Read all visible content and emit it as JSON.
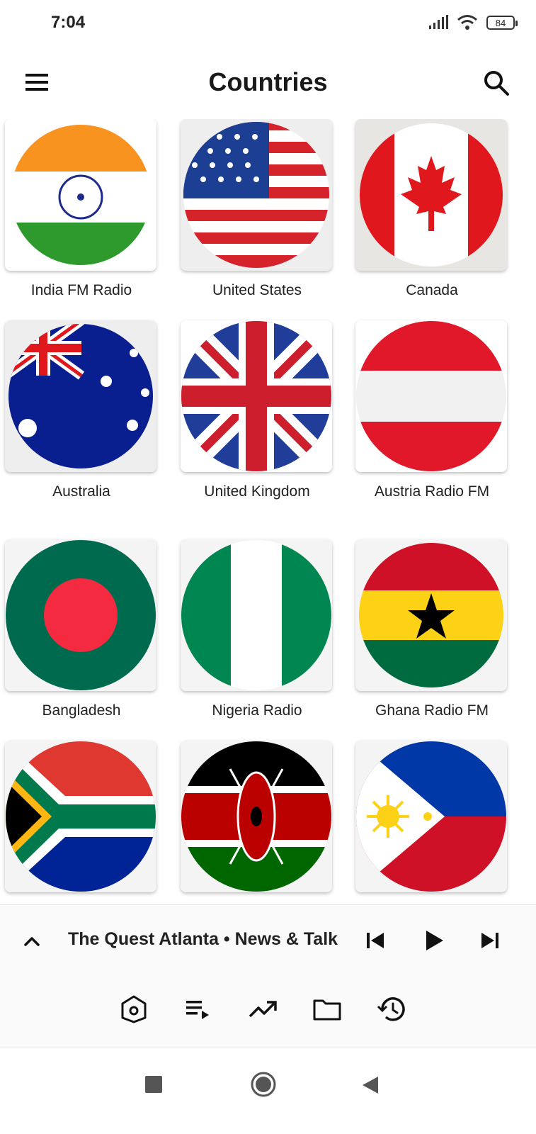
{
  "status_bar": {
    "time": "7:04",
    "battery": "84"
  },
  "app_bar": {
    "title": "Countries",
    "menu_icon": "hamburger-menu-icon",
    "search_icon": "search-icon"
  },
  "countries": [
    {
      "name": "India FM Radio",
      "flag": "india-flag-icon"
    },
    {
      "name": "United States",
      "flag": "usa-flag-icon"
    },
    {
      "name": "Canada",
      "flag": "canada-flag-icon"
    },
    {
      "name": "Australia",
      "flag": "australia-flag-icon"
    },
    {
      "name": "United Kingdom",
      "flag": "uk-flag-icon"
    },
    {
      "name": "Austria Radio FM",
      "flag": "austria-flag-icon"
    },
    {
      "name": "Bangladesh",
      "flag": "bangladesh-flag-icon"
    },
    {
      "name": "Nigeria Radio",
      "flag": "nigeria-flag-icon"
    },
    {
      "name": "Ghana Radio FM",
      "flag": "ghana-flag-icon"
    },
    {
      "flag": "south-africa-flag-icon"
    },
    {
      "flag": "kenya-flag-icon"
    },
    {
      "flag": "philippines-flag-icon"
    }
  ],
  "player": {
    "now_playing": "The Quest Atlanta • News & Talk"
  },
  "bottom_nav": [
    "home-icon",
    "queue-icon",
    "trending-icon",
    "folder-icon",
    "history-icon"
  ],
  "colors": {
    "background": "#ffffff",
    "text": "#1a1a1a"
  }
}
